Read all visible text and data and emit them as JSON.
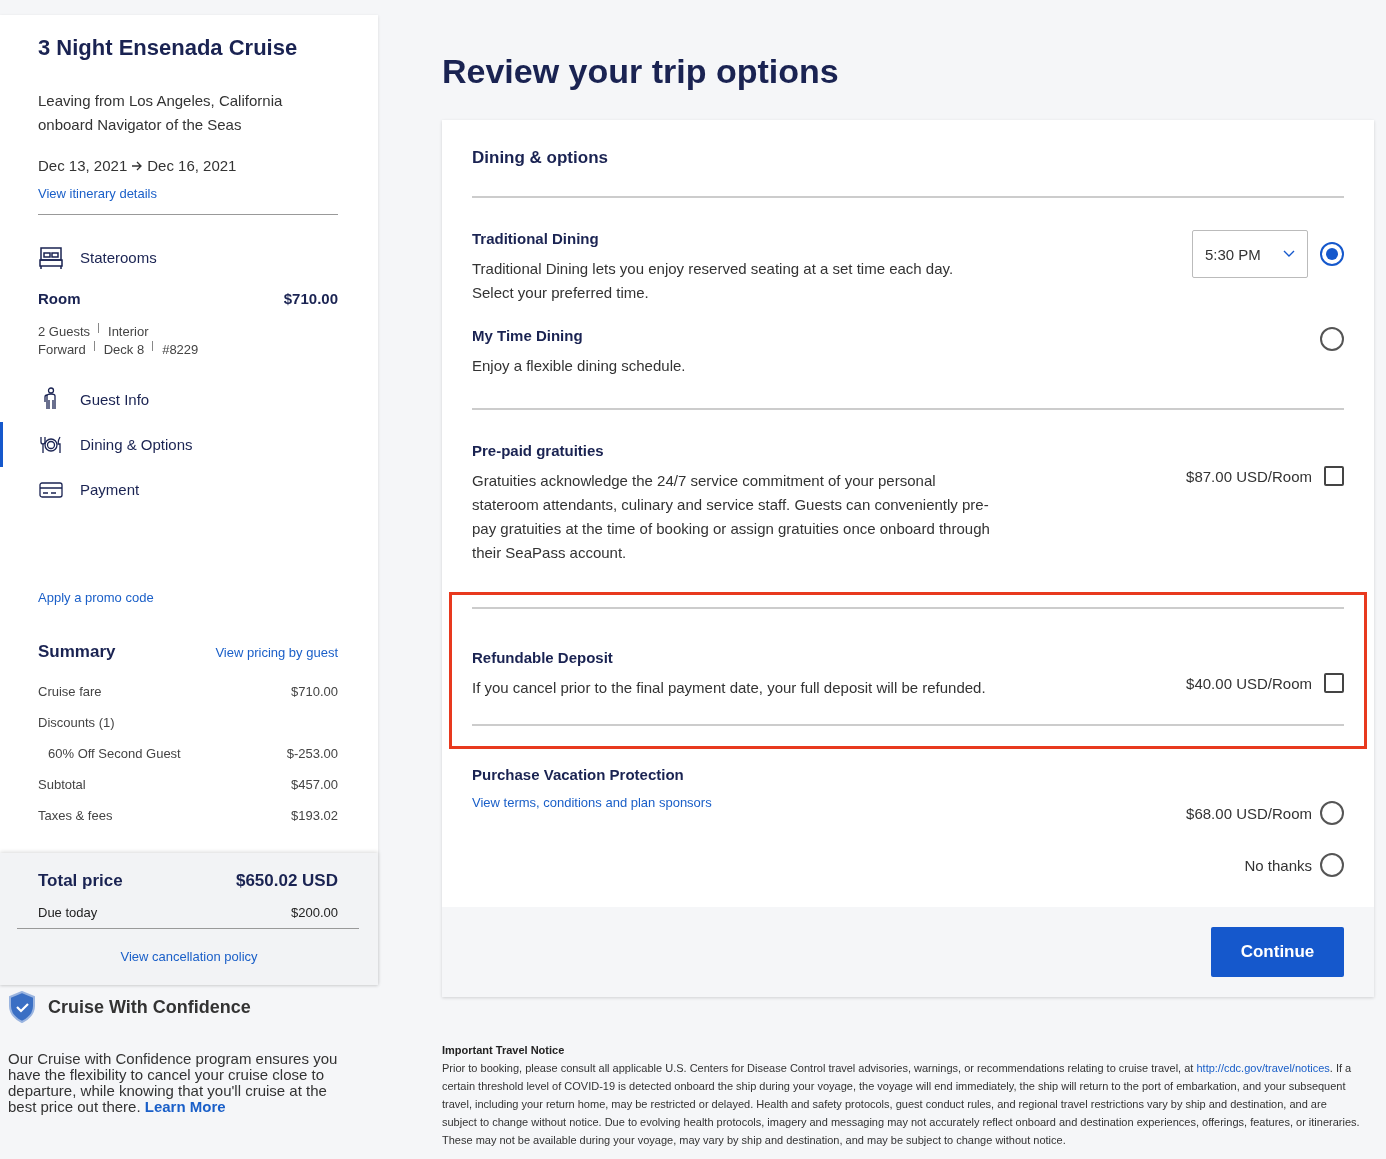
{
  "sidebar": {
    "cruise_title": "3 Night Ensenada Cruise",
    "departure": "Leaving from Los Angeles, California",
    "ship": "onboard Navigator of the Seas",
    "start_date": "Dec 13, 2021",
    "end_date": "Dec 16, 2021",
    "itinerary_link": "View itinerary details",
    "steps": [
      {
        "label": "Staterooms",
        "selected": false,
        "room": {
          "label": "Room",
          "price": "$710.00",
          "detail_lines": [
            [
              "2 Guests",
              "Interior"
            ],
            [
              "Forward",
              "Deck 8",
              "#8229"
            ]
          ]
        }
      },
      {
        "label": "Guest Info",
        "selected": false
      },
      {
        "label": "Dining & Options",
        "selected": true
      },
      {
        "label": "Payment",
        "selected": false
      }
    ],
    "promo_link": "Apply a promo code",
    "summary": {
      "title": "Summary",
      "pricing_link": "View pricing by guest",
      "lines": [
        {
          "label": "Cruise fare",
          "value": "$710.00"
        },
        {
          "label": "Discounts (1)",
          "children": [
            {
              "label": "60% Off Second Guest",
              "value": "$-253.00"
            }
          ]
        },
        {
          "label": "Subtotal",
          "value": "$457.00"
        },
        {
          "label": "Taxes & fees",
          "value": "$193.02"
        }
      ]
    },
    "total": {
      "label": "Total price",
      "value": "$650.02 USD",
      "due_label": "Due today",
      "due_value": "$200.00",
      "cancellation_link": "View cancellation policy"
    },
    "confidence": {
      "title": "Cruise With Confidence",
      "text": "Our Cruise with Confidence program ensures you have the flexibility to cancel your cruise close to departure, while knowing that you'll cruise at the best price out there.",
      "link": "Learn More"
    }
  },
  "main": {
    "title": "Review your trip options",
    "card": {
      "heading": "Dining & options",
      "sections": [
        {
          "kind": "dining",
          "options": [
            {
              "title": "Traditional Dining",
              "description": "Traditional Dining lets you enjoy reserved seating at a set time each day. Select your preferred time.",
              "time": "5:30 PM",
              "selected": true
            },
            {
              "title": "My Time Dining",
              "description": "Enjoy a flexible dining schedule.",
              "selected": false
            }
          ]
        },
        {
          "kind": "checkbox",
          "title": "Pre-paid gratuities",
          "description": "Gratuities acknowledge the 24/7 service commitment of your personal stateroom attendants, culinary and service staff. Guests can conveniently pre-pay gratuities at the time of booking or assign gratuities once onboard through their SeaPass account.",
          "price": "$87.00 USD/Room",
          "checked": false,
          "highlighted": false
        },
        {
          "kind": "checkbox",
          "title": "Refundable Deposit",
          "description": "If you cancel prior to the final payment date, your full deposit will be refunded.",
          "price": "$40.00 USD/Room",
          "checked": false,
          "highlighted": true
        },
        {
          "kind": "choices",
          "title": "Purchase Vacation Protection",
          "link": "View terms, conditions and plan sponsors",
          "choices": [
            {
              "label": "$68.00 USD/Room",
              "selected": false
            },
            {
              "label": "No thanks",
              "selected": false
            }
          ]
        }
      ],
      "continue_button": "Continue"
    },
    "notice": {
      "title": "Important Travel Notice",
      "text_before": "Prior to booking, please consult all applicable U.S. Centers for Disease Control travel advisories, warnings, or recommendations relating to cruise travel, at",
      "link": "http://cdc.gov/travel/notices",
      "text_after": ". If a certain threshold level of COVID-19 is detected onboard the ship during your voyage, the voyage will end immediately, the ship will return to the port of embarkation, and your subsequent travel, including your return home, may be restricted or delayed. Health and safety protocols, guest conduct rules, and regional travel restrictions vary by ship and destination, and are subject to change without notice. Due to evolving health protocols, imagery and messaging may not accurately reflect onboard and destination experiences, offerings, features, or itineraries. These may not be available during your voyage, may vary by ship and destination, and may be subject to change without notice."
    }
  }
}
